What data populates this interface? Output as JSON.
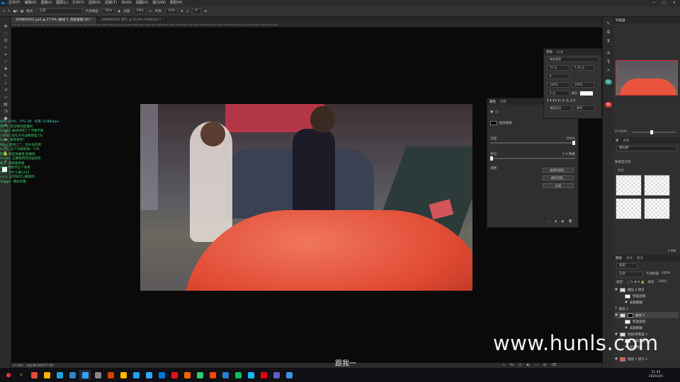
{
  "menu": {
    "items": [
      "文件(F)",
      "编辑(E)",
      "图像(I)",
      "图层(L)",
      "文字(Y)",
      "选择(S)",
      "滤镜(T)",
      "3D(D)",
      "视图(V)",
      "窗口(W)",
      "帮助(H)"
    ]
  },
  "options": {
    "mode_label": "模式:",
    "mode_value": "正常",
    "opacity_label": "不透明度:",
    "opacity_value": "56%",
    "flow_label": "流量:",
    "flow_value": "59%",
    "smooth_label": "平滑:",
    "smooth_value": "10%",
    "angle_value": "0°"
  },
  "tabs": [
    {
      "label": "20SM09451.psd @ 27.9% (曲线 1, 图层蒙版/16) *",
      "active": true
    },
    {
      "label": "20SM09451 拷贝 @ 50.0% (RGB/16) *",
      "active": false
    }
  ],
  "ruler_text": "0  50  100  150  200  250  300  350  400  450  500  550  600  650  700  750  800  850  900  950  1000 1050 1100 1150 1200 1250 1300 1350 1400 1450 1500 1550 1600 1650 1700 1750 1800 1850 1900 1950 2000 2050 2100 2150 2200 2250 2300 2350 2400",
  "stream": {
    "stats": [
      "CPU: 0.0%",
      "FPS: 80",
      "码率: 6188kbps"
    ],
    "lines": [
      "用户1: 欢迎来到直播间",
      "Cindie: 曲线调完了? 不要不要",
      "小水彩: 就在天时战略那里 [5]",
      "hehe: 来吧来吧?",
      "Mike: 安排上了，因水去的吧",
      "hunls: 这个效果能发一下吗",
      "阿凯: 就是加曲线 加曲线",
      "Cindie: 这蒙版用黑白画笔修",
      "影子: 我来看看看",
      "abc: 我想学这个效果",
      "Tom: 为什么要1242",
      "Lucy: 这时候可以蒙版的",
      "dogger: 看好的哦"
    ]
  },
  "props_panel": {
    "tab1": "属性",
    "tab2": "调整",
    "title": "图层蒙版",
    "density_label": "浓度:",
    "density_value": "100%",
    "feather_label": "羽化:",
    "feather_value": "0.0 像素",
    "refine_label": "调整:",
    "btn_select": "选择并遮住...",
    "btn_range": "颜色范围...",
    "btn_invert": "反相"
  },
  "char_panel": {
    "tab1": "字符",
    "tab2": "段落",
    "font": "微软雅黑",
    "style": "Bold",
    "size": "72 点",
    "leading": "5.76 点",
    "tracking": "0",
    "scale_v": "100%",
    "scale_h": "100%",
    "baseline": "0 点",
    "color_label": "颜色:",
    "lang": "美国英语",
    "aa": "犀利"
  },
  "right_panel": {
    "nav_tab": "导航器",
    "zoom": "27.92%",
    "swatch_tab1": "库",
    "swatch_tab2": "调整",
    "lib_name": "我的库",
    "view_mode": "按类型分组",
    "group": "颜色",
    "swatches": [
      "ffffff",
      "ffffff",
      "ffffff",
      "ffffff"
    ],
    "size_label": "3 MB",
    "layers_tab1": "图层",
    "layers_tab2": "通道",
    "layers_tab3": "路径",
    "filter": "类型",
    "blend": "正常",
    "opacity_label": "不透明度:",
    "opacity": "100%",
    "lock_label": "锁定:",
    "fill_label": "填充:",
    "fill": "100%",
    "layers": [
      {
        "name": "图层 2 拷贝",
        "sel": false
      },
      {
        "name": "智能滤镜",
        "sel": false
      },
      {
        "name": "高斯模糊",
        "sel": false
      },
      {
        "name": "图层 2",
        "sel": false
      },
      {
        "name": "曲线 1",
        "sel": true
      },
      {
        "name": "智能滤镜",
        "sel": false
      },
      {
        "name": "高斯模糊",
        "sel": false
      },
      {
        "name": "色相/饱和度 1",
        "sel": false
      },
      {
        "name": "智能滤镜",
        "sel": false
      },
      {
        "name": "高斯模糊",
        "sel": false
      },
      {
        "name": "图层 1 拷贝 2",
        "sel": false
      }
    ]
  },
  "status": {
    "zoom": "27.93%",
    "doc": "文档:86.9M/257.8M"
  },
  "subtitle": "跟我一",
  "watermark": "www.hunls.com",
  "taskbar": {
    "time": "21:43",
    "date": "2020/3/5",
    "icon_colors": [
      "#e84a3b",
      "#f4b400",
      "#1fa3e0",
      "#2f84c4",
      "#31a8ff",
      "#888888",
      "#d83b01",
      "#ffb900",
      "#1da1f2",
      "#31a8ff",
      "#0078d7",
      "#e81123",
      "#f7630c",
      "#2ecc71",
      "#ff4500",
      "#2d7dd2",
      "#07c160",
      "#12b7f5",
      "#e60012",
      "#5b5fc7",
      "#3a96dd"
    ]
  }
}
